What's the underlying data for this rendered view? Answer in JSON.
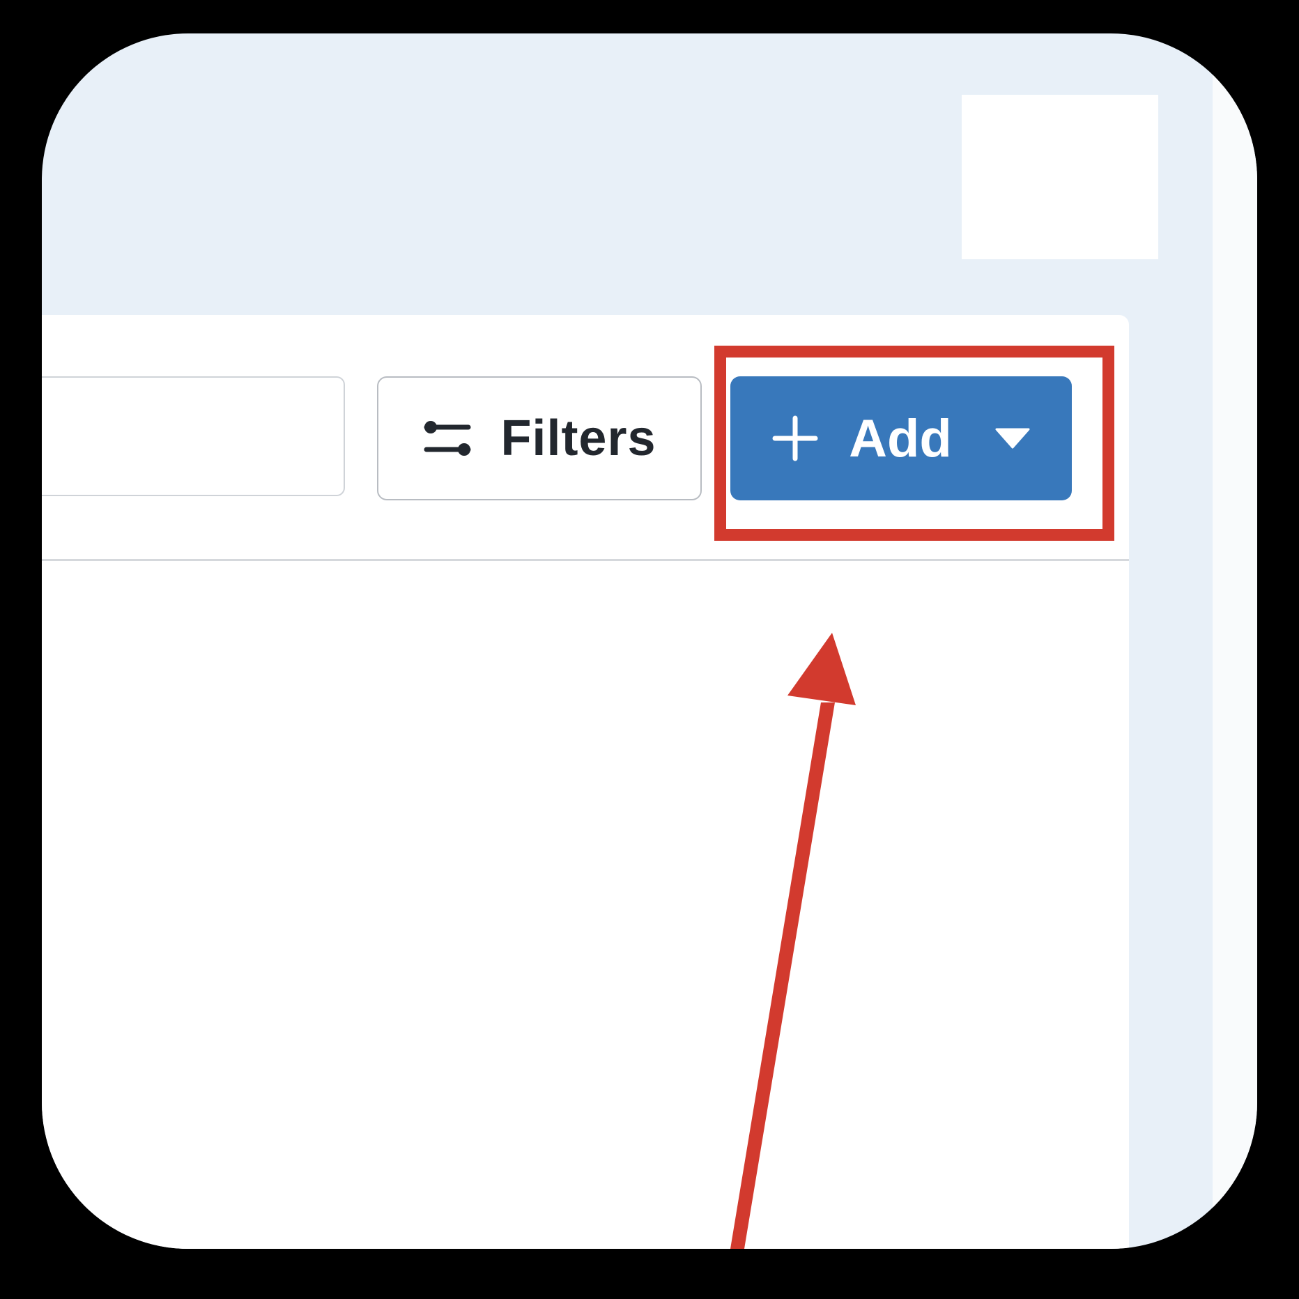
{
  "toolbar": {
    "filters_label": "Filters",
    "add_label": "Add"
  },
  "icons": {
    "filters": "sliders-icon",
    "add": "plus-icon",
    "add_dropdown": "caret-down-icon",
    "annotation": "arrow-icon"
  },
  "colors": {
    "page_background": "#e8f0f8",
    "panel_background": "#ffffff",
    "primary_button": "#3878bb",
    "annotation": "#d23a2e",
    "text_dark": "#22272e"
  }
}
